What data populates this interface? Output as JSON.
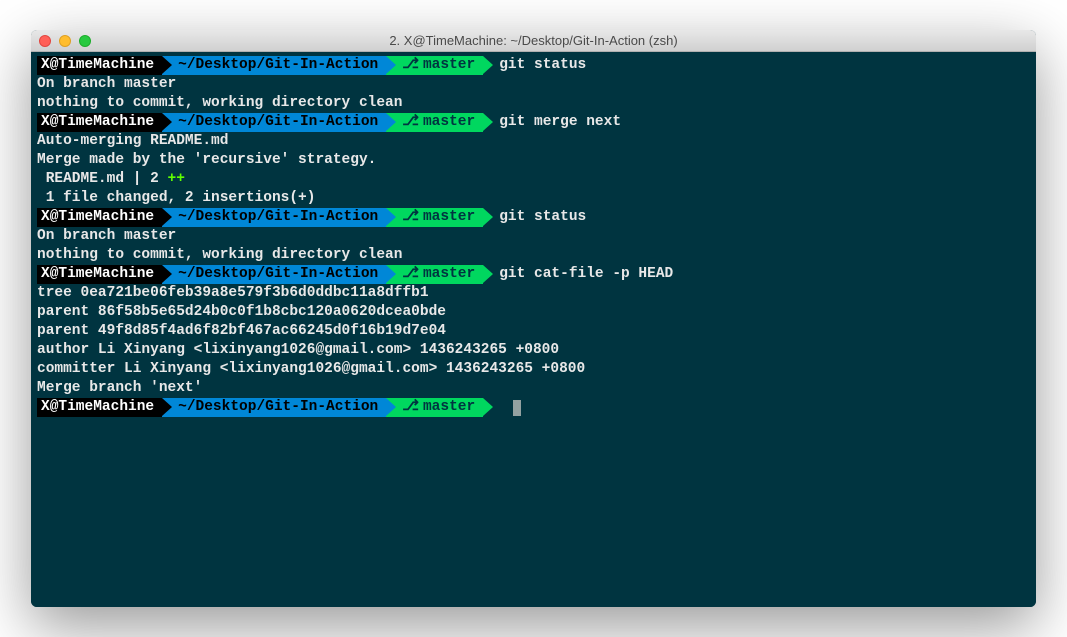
{
  "window": {
    "title": "2. X@TimeMachine: ~/Desktop/Git-In-Action (zsh)"
  },
  "prompt": {
    "user": "X@TimeMachine",
    "path": "~/Desktop/Git-In-Action",
    "branch": "master",
    "branch_icon": "⎇"
  },
  "blocks": [
    {
      "command": "git status",
      "output": [
        {
          "text": "On branch master"
        },
        {
          "text": "nothing to commit, working directory clean"
        }
      ]
    },
    {
      "command": "git merge next",
      "output": [
        {
          "text": "Auto-merging README.md"
        },
        {
          "text": "Merge made by the 'recursive' strategy."
        },
        {
          "segments": [
            {
              "text": " README.md | 2 "
            },
            {
              "text": "++",
              "class": "green-text"
            }
          ]
        },
        {
          "text": " 1 file changed, 2 insertions(+)"
        }
      ]
    },
    {
      "command": "git status",
      "output": [
        {
          "text": "On branch master"
        },
        {
          "text": "nothing to commit, working directory clean"
        }
      ]
    },
    {
      "command": "git cat-file -p HEAD",
      "output": [
        {
          "text": "tree 0ea721be06feb39a8e579f3b6d0ddbc11a8dffb1"
        },
        {
          "text": "parent 86f58b5e65d24b0c0f1b8cbc120a0620dcea0bde"
        },
        {
          "text": "parent 49f8d85f4ad6f82bf467ac66245d0f16b19d7e04"
        },
        {
          "text": "author Li Xinyang <lixinyang1026@gmail.com> 1436243265 +0800"
        },
        {
          "text": "committer Li Xinyang <lixinyang1026@gmail.com> 1436243265 +0800"
        },
        {
          "text": ""
        },
        {
          "text": "Merge branch 'next'"
        }
      ]
    },
    {
      "command": "",
      "cursor": true,
      "output": []
    }
  ]
}
